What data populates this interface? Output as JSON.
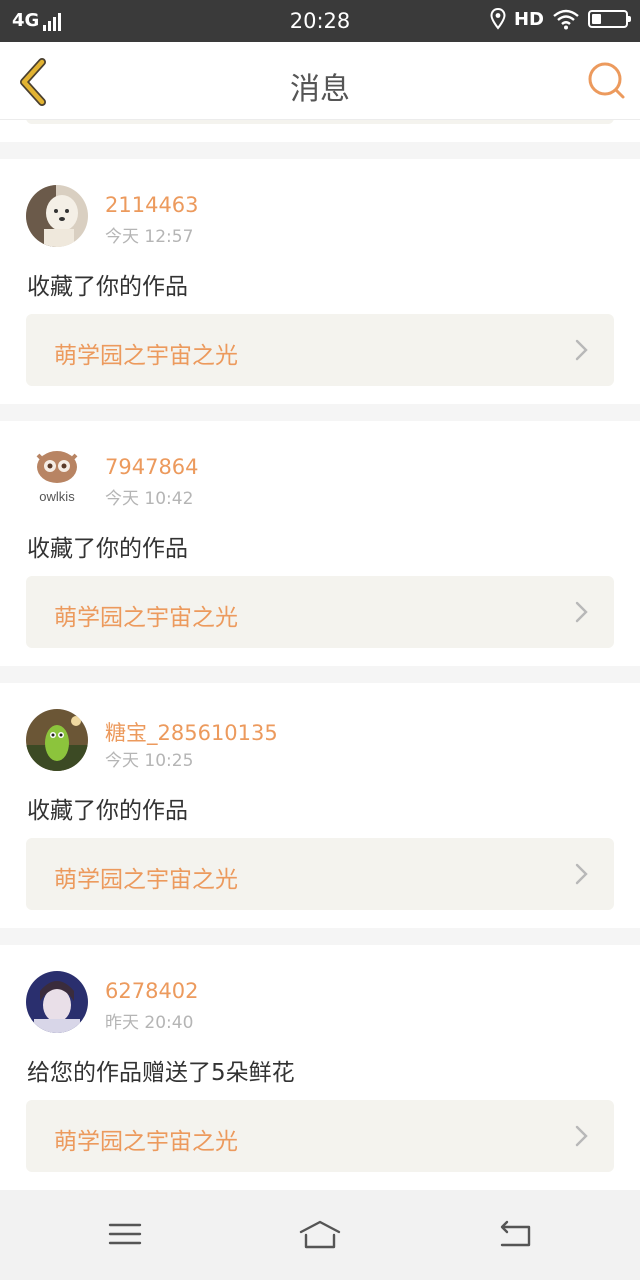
{
  "status_bar": {
    "network": "4G",
    "time": "20:28",
    "hd": "HD"
  },
  "navbar": {
    "title": "消息"
  },
  "messages": [
    {
      "user": "2114463",
      "time": "今天 12:57",
      "action": "收藏了你的作品",
      "work": "萌学园之宇宙之光"
    },
    {
      "user": "7947864",
      "time": "今天 10:42",
      "action": "收藏了你的作品",
      "work": "萌学园之宇宙之光",
      "avatar_text": "owlkis"
    },
    {
      "user": "糖宝_285610135",
      "time": "今天 10:25",
      "action": "收藏了你的作品",
      "work": "萌学园之宇宙之光"
    },
    {
      "user": "6278402",
      "time": "昨天 20:40",
      "action": "给您的作品赠送了5朵鲜花",
      "work": "萌学园之宇宙之光"
    }
  ],
  "colors": {
    "accent": "#ec9a5d",
    "back_icon": "#e2b332",
    "card_box": "#f4f3ee"
  },
  "icons": {
    "back": "back-chevron-icon",
    "search": "search-icon",
    "menu": "menu-icon",
    "home": "home-icon",
    "return": "return-icon"
  }
}
